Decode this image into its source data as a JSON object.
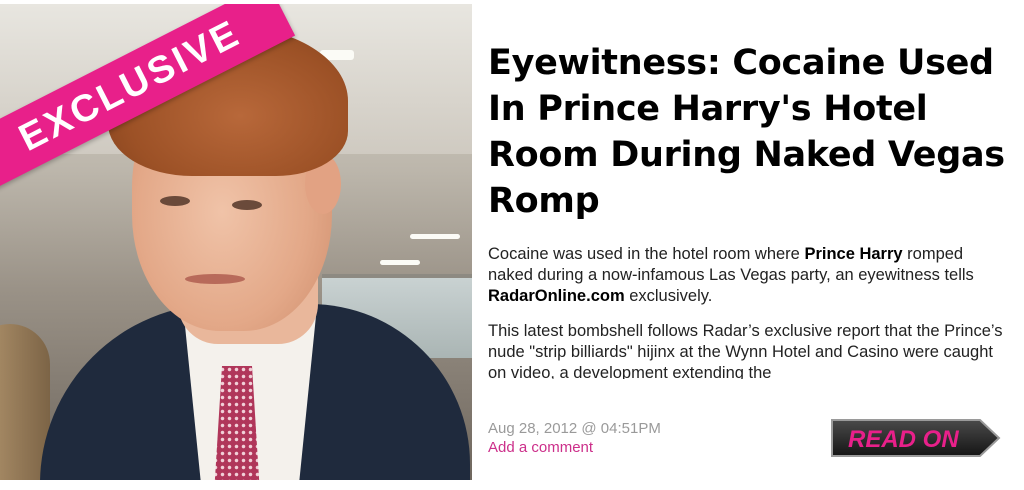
{
  "banner": {
    "label": "EXCLUSIVE"
  },
  "article": {
    "title": "Eyewitness: Cocaine Used In Prince Harry's Hotel Room During Naked Vegas Romp",
    "p1": {
      "a": "Cocaine was used in the hotel room where ",
      "b": "Prince Harry",
      "c": " romped naked during a now-infamous Las Vegas party, an eyewitness tells ",
      "d": "RadarOnline.com",
      "e": " exclusively."
    },
    "p2": "This latest bombshell follows Radar’s exclusive report that the Prince’s nude \"strip billiards\" hijinx at the Wynn Hotel and Casino were caught on video, a development extending the",
    "date": "Aug 28, 2012 @ 04:51PM",
    "comment_link": "Add a comment",
    "read_on": "READ ON"
  },
  "colors": {
    "accent": "#e8208a",
    "link": "#cc2f8a",
    "read_on_bg": "#2a2a2a",
    "read_on_text": "#e8208a"
  }
}
